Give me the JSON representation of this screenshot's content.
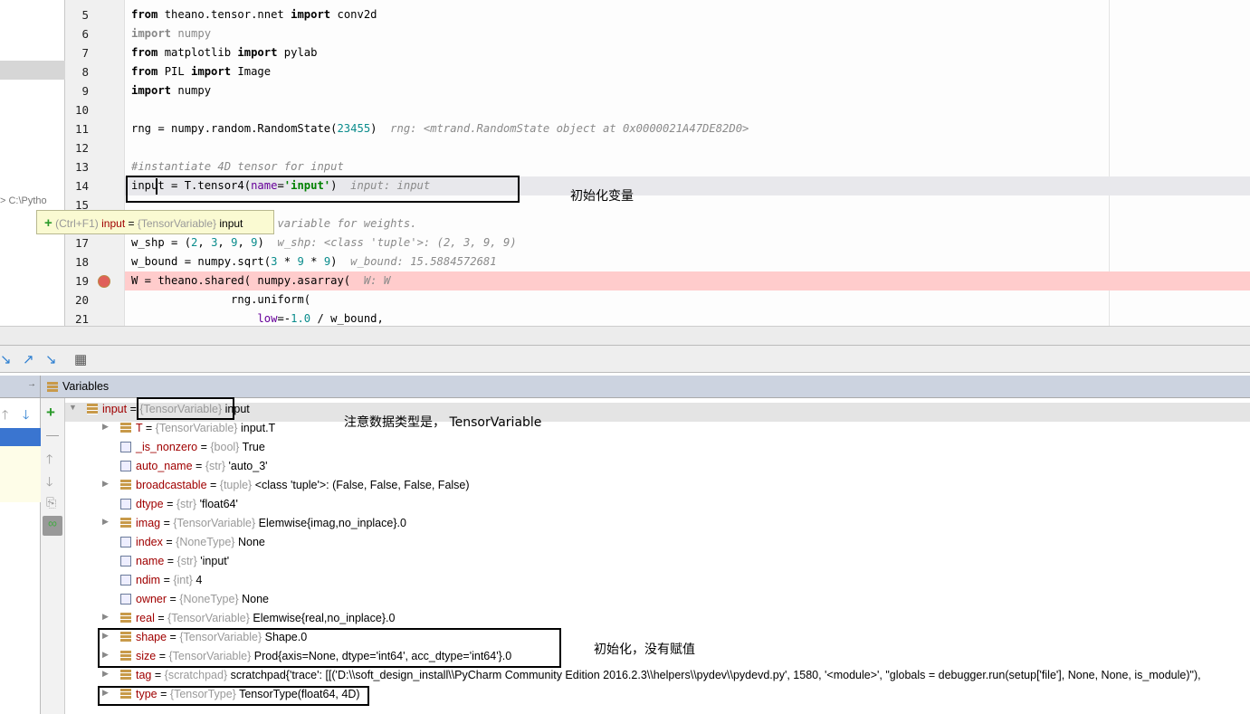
{
  "editor": {
    "lines": [
      {
        "n": "5",
        "segs": [
          [
            "from",
            "kw"
          ],
          [
            " theano.tensor.nnet ",
            ""
          ],
          [
            "import",
            "kw"
          ],
          [
            " conv2d",
            ""
          ]
        ]
      },
      {
        "n": "6",
        "segs": [
          [
            "import",
            "kw gray"
          ],
          [
            " numpy",
            "gray"
          ]
        ]
      },
      {
        "n": "7",
        "segs": [
          [
            "from",
            "kw"
          ],
          [
            " matplotlib ",
            ""
          ],
          [
            "import",
            "kw"
          ],
          [
            " pylab",
            ""
          ]
        ]
      },
      {
        "n": "8",
        "segs": [
          [
            "from",
            "kw"
          ],
          [
            " PIL ",
            ""
          ],
          [
            "import",
            "kw"
          ],
          [
            " Image",
            ""
          ]
        ]
      },
      {
        "n": "9",
        "segs": [
          [
            "import",
            "kw"
          ],
          [
            " numpy",
            ""
          ]
        ]
      },
      {
        "n": "10",
        "segs": []
      },
      {
        "n": "11",
        "segs": [
          [
            "rng = numpy.random.RandomState(",
            ""
          ],
          [
            "23455",
            "num"
          ],
          [
            ")",
            ""
          ],
          [
            "  rng: <mtrand.RandomState object at 0x0000021A47DE82D0>",
            "hint"
          ]
        ]
      },
      {
        "n": "12",
        "segs": []
      },
      {
        "n": "13",
        "segs": [
          [
            "#instantiate 4D tensor for input",
            "cm"
          ]
        ]
      },
      {
        "n": "14",
        "segs": [
          [
            "input = T.tensor4(",
            ""
          ],
          [
            "name",
            "param"
          ],
          [
            "=",
            ""
          ],
          [
            "'input'",
            "str"
          ],
          [
            ")",
            ""
          ],
          [
            "  input: input",
            "hint"
          ]
        ]
      },
      {
        "n": "15",
        "segs": []
      },
      {
        "n": "16",
        "segs": [
          [
            "                    d variable for weights.",
            "cm"
          ]
        ]
      },
      {
        "n": "17",
        "segs": [
          [
            "w_shp = (",
            ""
          ],
          [
            "2",
            "num"
          ],
          [
            ", ",
            ""
          ],
          [
            "3",
            "num"
          ],
          [
            ", ",
            ""
          ],
          [
            "9",
            "num"
          ],
          [
            ", ",
            ""
          ],
          [
            "9",
            "num"
          ],
          [
            ")",
            ""
          ],
          [
            "  w_shp: <class 'tuple'>: (2, 3, 9, 9)",
            "hint"
          ]
        ]
      },
      {
        "n": "18",
        "segs": [
          [
            "w_bound = numpy.sqrt(",
            ""
          ],
          [
            "3",
            "num"
          ],
          [
            " * ",
            ""
          ],
          [
            "9",
            "num"
          ],
          [
            " * ",
            ""
          ],
          [
            "9",
            "num"
          ],
          [
            ")",
            ""
          ],
          [
            "  w_bound: 15.5884572681",
            "hint"
          ]
        ]
      },
      {
        "n": "19",
        "segs": [
          [
            "W = theano.shared( numpy.asarray(",
            ""
          ],
          [
            "  W: W",
            "hint"
          ]
        ]
      },
      {
        "n": "20",
        "segs": [
          [
            "               rng.uniform(",
            ""
          ]
        ]
      },
      {
        "n": "21",
        "segs": [
          [
            "                   ",
            ""
          ],
          [
            "low",
            "param"
          ],
          [
            "=-",
            ""
          ],
          [
            "1.0",
            "num"
          ],
          [
            " / w_bound,",
            ""
          ]
        ]
      }
    ],
    "current_line": "14",
    "breakpoint_line": "19",
    "breakpoint_color": "#ffcccc",
    "path_label": "> C:\\Pytho",
    "tooltip": {
      "shortcut": "(Ctrl+F1)",
      "name": "input",
      "eq": " = ",
      "type": "{TensorVariable}",
      "value": " input"
    }
  },
  "annotations": {
    "a1": "初始化变量",
    "a2": "注意数据类型是，  TensorVariable",
    "a3": "初始化，没有赋值"
  },
  "debugger": {
    "variables_title": "Variables",
    "root": {
      "name": "input",
      "type": "{TensorVariable}",
      "value": "input"
    },
    "children": [
      {
        "name": "T",
        "type": "{TensorVariable}",
        "value": "input.T",
        "icon": "obj",
        "exp": true
      },
      {
        "name": "_is_nonzero",
        "type": "{bool}",
        "value": "True",
        "icon": "prim",
        "exp": false
      },
      {
        "name": "auto_name",
        "type": "{str}",
        "value": "'auto_3'",
        "icon": "prim",
        "exp": false
      },
      {
        "name": "broadcastable",
        "type": "{tuple}",
        "value": "<class 'tuple'>: (False, False, False, False)",
        "icon": "obj",
        "exp": true
      },
      {
        "name": "dtype",
        "type": "{str}",
        "value": "'float64'",
        "icon": "prim",
        "exp": false
      },
      {
        "name": "imag",
        "type": "{TensorVariable}",
        "value": "Elemwise{imag,no_inplace}.0",
        "icon": "obj",
        "exp": true
      },
      {
        "name": "index",
        "type": "{NoneType}",
        "value": "None",
        "icon": "prim",
        "exp": false
      },
      {
        "name": "name",
        "type": "{str}",
        "value": "'input'",
        "icon": "prim",
        "exp": false
      },
      {
        "name": "ndim",
        "type": "{int}",
        "value": "4",
        "icon": "prim",
        "exp": false
      },
      {
        "name": "owner",
        "type": "{NoneType}",
        "value": "None",
        "icon": "prim",
        "exp": false
      },
      {
        "name": "real",
        "type": "{TensorVariable}",
        "value": "Elemwise{real,no_inplace}.0",
        "icon": "obj",
        "exp": true
      },
      {
        "name": "shape",
        "type": "{TensorVariable}",
        "value": "Shape.0",
        "icon": "obj",
        "exp": true
      },
      {
        "name": "size",
        "type": "{TensorVariable}",
        "value": "Prod{axis=None, dtype='int64', acc_dtype='int64'}.0",
        "icon": "obj",
        "exp": true
      },
      {
        "name": "tag",
        "type": "{scratchpad}",
        "value": "scratchpad{'trace': [[('D:\\\\soft_design_install\\\\PyCharm Community Edition 2016.2.3\\\\helpers\\\\pydev\\\\pydevd.py', 1580, '<module>', \"globals = debugger.run(setup['file'], None, None, is_module)\"),",
        "icon": "obj",
        "exp": true
      },
      {
        "name": "type",
        "type": "{TensorType}",
        "value": "TensorType(float64, 4D)",
        "icon": "obj",
        "exp": true
      }
    ]
  }
}
